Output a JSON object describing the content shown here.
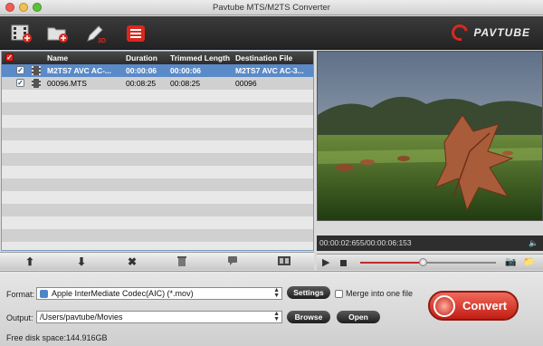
{
  "window": {
    "title": "Pavtube MTS/M2TS Converter"
  },
  "toolbar": {
    "brand": "PAVTUBE",
    "buttons": [
      "add-video-icon",
      "add-folder-icon",
      "edit-icon",
      "task-list-icon"
    ]
  },
  "file_list": {
    "columns": [
      "Name",
      "Duration",
      "Trimmed Length",
      "Destination File"
    ],
    "rows": [
      {
        "checked": true,
        "name": "M2TS7 AVC AC-...",
        "duration": "00:00:06",
        "trimmed": "00:00:06",
        "destination": "M2TS7 AVC AC-3...",
        "selected": true
      },
      {
        "checked": true,
        "name": "00096.MTS",
        "duration": "00:08:25",
        "trimmed": "00:08:25",
        "destination": "00096",
        "selected": false
      }
    ],
    "toolbar_icons": [
      "move-up-icon",
      "move-down-icon",
      "remove-icon",
      "trash-icon",
      "comment-icon",
      "merge-icon"
    ]
  },
  "preview": {
    "time": "00:00:02:655/00:00:06:153",
    "progress": 0.46
  },
  "bottom": {
    "format_label": "Format:",
    "format_value": "Apple InterMediate Codec(AIC) (*.mov)",
    "settings_label": "Settings",
    "merge_label": "Merge into one file",
    "output_label": "Output:",
    "output_value": "/Users/pavtube/Movies",
    "browse_label": "Browse",
    "open_label": "Open",
    "disk_space": "Free disk space:144.916GB",
    "convert_label": "Convert"
  },
  "colors": {
    "accent": "#c42a2a",
    "selection": "#5a8ac8",
    "toolbar_bg": "#2c2c2c"
  }
}
